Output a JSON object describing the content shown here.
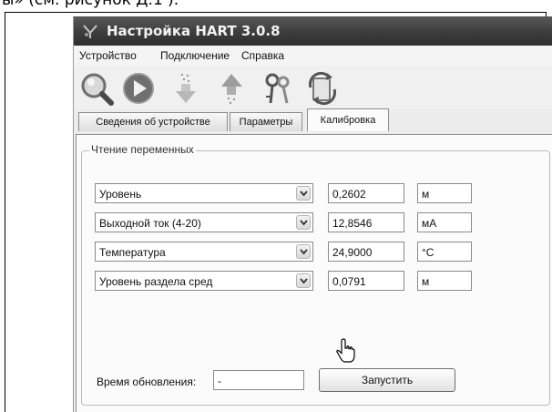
{
  "caption": "ы» (см. рисунок Д.1 ).",
  "window": {
    "title": "Настройка HART 3.0.8"
  },
  "menu": [
    "Устройство",
    "Подключение",
    "Справка"
  ],
  "toolbar": {
    "icons": [
      "search-icon",
      "play-icon",
      "download-arrow-icon",
      "upload-arrow-icon",
      "keys-icon",
      "refresh-icon"
    ]
  },
  "tabs": [
    {
      "label": "Сведения об устройстве",
      "active": false
    },
    {
      "label": "Параметры",
      "active": false
    },
    {
      "label": "Калибровка",
      "active": true
    }
  ],
  "group": {
    "title": "Чтение переменных",
    "rows": [
      {
        "variable": "Уровень",
        "value": "0,2602",
        "unit": "м"
      },
      {
        "variable": "Выходной ток (4-20)",
        "value": "12,8546",
        "unit": "мА"
      },
      {
        "variable": "Температура",
        "value": "24,9000",
        "unit": "°C"
      },
      {
        "variable": "Уровень раздела сред",
        "value": "0,0791",
        "unit": "м"
      }
    ]
  },
  "update": {
    "label": "Время обновления:",
    "value": "-"
  },
  "run_button": "Запустить"
}
